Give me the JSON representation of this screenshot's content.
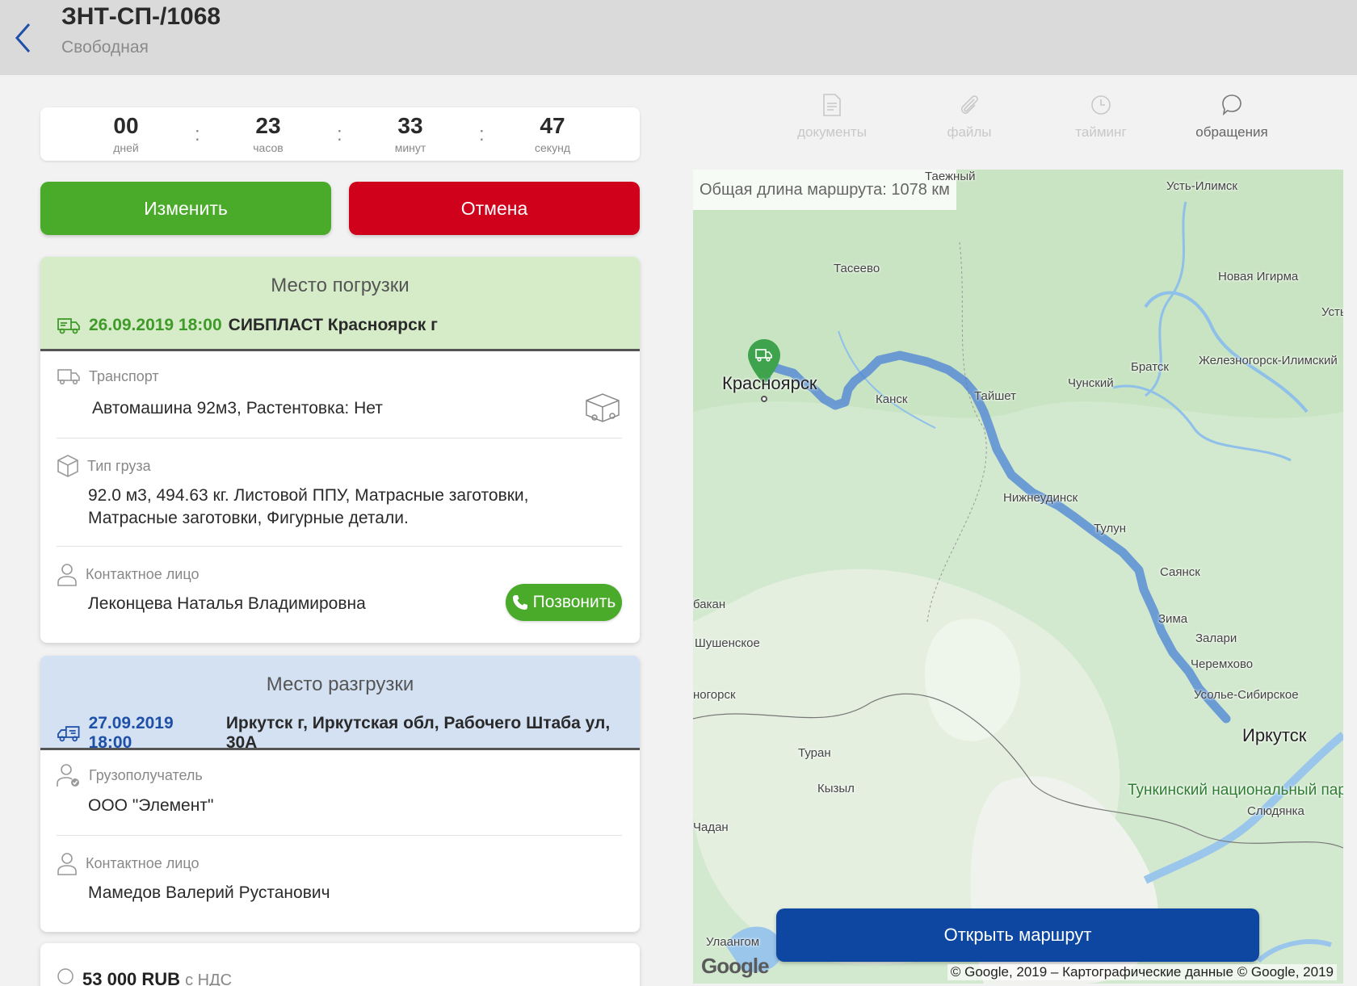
{
  "header": {
    "title": "ЗНТ-СП-/1068",
    "subtitle": "Свободная"
  },
  "timer": {
    "days": "00",
    "days_label": "дней",
    "hours": "23",
    "hours_label": "часов",
    "minutes": "33",
    "minutes_label": "минут",
    "seconds": "47",
    "seconds_label": "секунд",
    "separator": ":"
  },
  "actions": {
    "edit_label": "Изменить",
    "cancel_label": "Отмена"
  },
  "loading": {
    "title": "Место погрузки",
    "date": "26.09.2019 18:00",
    "address": "СИБПЛАСТ Красноярск г",
    "transport_label": "Транспорт",
    "transport_value": "Автомашина 92м3, Растентовка: Нет",
    "cargo_label": "Тип груза",
    "cargo_value": "92.0 м3, 494.63 кг. Листовой ППУ, Матрасные заготовки, Матрасные заготовки, Фигурные детали.",
    "contact_label": "Контактное лицо",
    "contact_value": "Леконцева Наталья Владимировна",
    "call_label": "Позвонить"
  },
  "unloading": {
    "title": "Место разгрузки",
    "date": "27.09.2019 18:00",
    "address": "Иркутск г, Иркутская обл, Рабочего Штаба ул, 30А",
    "consignee_label": "Грузополучатель",
    "consignee_value": "ООО \"Элемент\"",
    "contact_label": "Контактное лицо",
    "contact_value": "Мамедов Валерий Рустанович"
  },
  "price": {
    "amount": "53 000 RUB",
    "vat": "с НДС"
  },
  "tabs": [
    {
      "label": "документы"
    },
    {
      "label": "файлы"
    },
    {
      "label": "тайминг"
    },
    {
      "label": "обращения"
    }
  ],
  "map": {
    "route_length": "Общая длина маршрута: 1078 км",
    "open_route_label": "Открыть маршрут",
    "copyright": "© Google, 2019 – Картографические данные © Google, 2019",
    "logo": "Google",
    "cities": {
      "taezhny": "Таежный",
      "ust_ilimsk": "Усть-Илимск",
      "taseevo": "Тасеево",
      "novaya_igirma": "Новая Игирма",
      "ust_k": "Усть-І",
      "zheleznogorsk": "Железногорск-Илимский",
      "krasnoyarsk": "Красноярск",
      "kansk": "Канск",
      "tayshet": "Тайшет",
      "chunsky": "Чунский",
      "bratsk": "Братск",
      "nizhneudinsk": "Нижнеудинск",
      "tulun": "Тулун",
      "sayansk": "Саянск",
      "abakan": "бакан",
      "zima": "Зима",
      "zalari": "Залари",
      "shushenskoe": "Шушенское",
      "cheremkhovo": "Черемхово",
      "gorsk": "ногорск",
      "usolye": "Усолье-Сибирское",
      "irkutsk": "Иркутск",
      "turan": "Туран",
      "kyzyl": "Кызыл",
      "tunkinsky": "Тункинский национальный парк",
      "slyudyanka": "Слюдянка",
      "chadan": "Чадан",
      "ulaangom": "Улаангом"
    }
  }
}
